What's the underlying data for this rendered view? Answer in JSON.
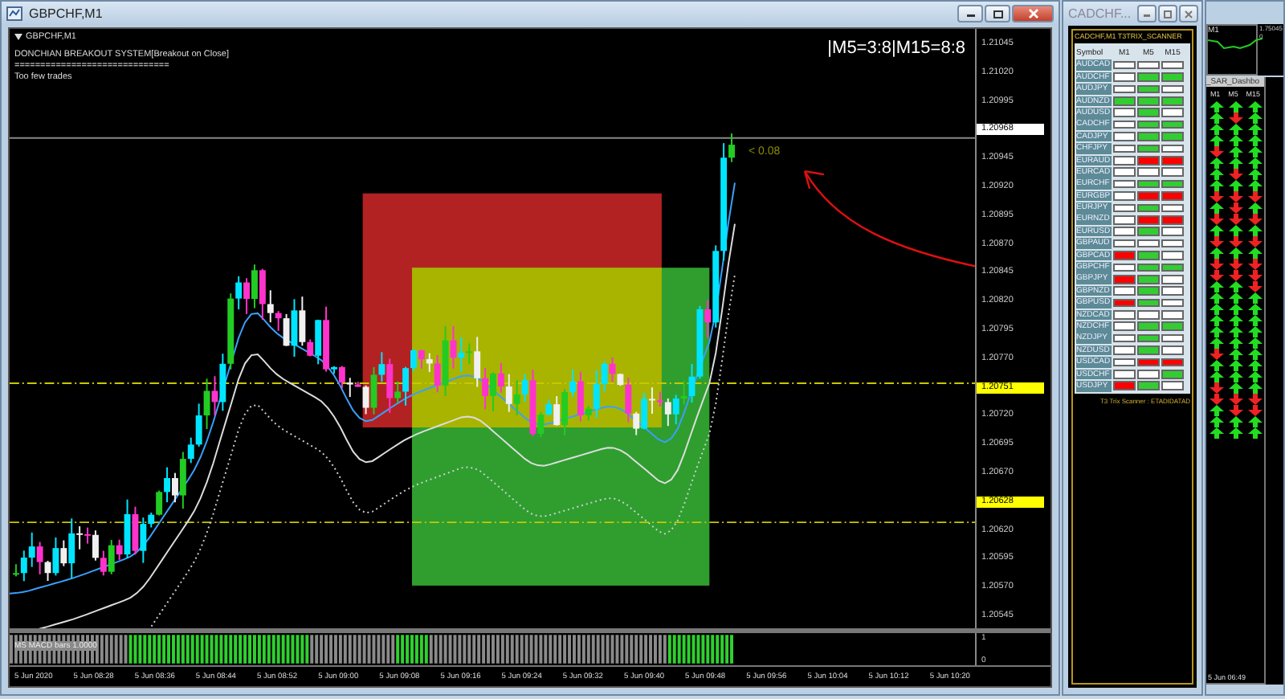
{
  "window": {
    "title": "GBPCHF,M1"
  },
  "chart": {
    "symbol": "GBPCHF,M1",
    "indicator_lines": [
      "DONCHIAN BREAKOUT SYSTEM[Breakout on Close]",
      "==============================",
      "Too few trades"
    ],
    "mtf_status": "|M5=3:8|M15=8:8",
    "price_note": "< 0.08",
    "price_axis": [
      {
        "label": "1.21045",
        "kind": "tick"
      },
      {
        "label": "1.21020",
        "kind": "tick"
      },
      {
        "label": "1.20995",
        "kind": "tick"
      },
      {
        "label": "1.20968",
        "kind": "current"
      },
      {
        "label": "1.20945",
        "kind": "tick"
      },
      {
        "label": "1.20920",
        "kind": "tick"
      },
      {
        "label": "1.20895",
        "kind": "tick"
      },
      {
        "label": "1.20870",
        "kind": "tick"
      },
      {
        "label": "1.20845",
        "kind": "tick"
      },
      {
        "label": "1.20820",
        "kind": "tick"
      },
      {
        "label": "1.20795",
        "kind": "tick"
      },
      {
        "label": "1.20770",
        "kind": "tick"
      },
      {
        "label": "1.20751",
        "kind": "level"
      },
      {
        "label": "1.20720",
        "kind": "tick"
      },
      {
        "label": "1.20695",
        "kind": "tick"
      },
      {
        "label": "1.20670",
        "kind": "tick"
      },
      {
        "label": "1.20628",
        "kind": "level"
      },
      {
        "label": "1.20620",
        "kind": "tick"
      },
      {
        "label": "1.20595",
        "kind": "tick"
      },
      {
        "label": "1.20570",
        "kind": "tick"
      },
      {
        "label": "1.20545",
        "kind": "tick"
      }
    ],
    "indicator": {
      "label": "MS MACD bars 1.0000",
      "scale": [
        "1",
        "0"
      ]
    },
    "time_axis": [
      "5 Jun 2020",
      "5 Jun 08:28",
      "5 Jun 08:36",
      "5 Jun 08:44",
      "5 Jun 08:52",
      "5 Jun 09:00",
      "5 Jun 09:08",
      "5 Jun 09:16",
      "5 Jun 09:24",
      "5 Jun 09:32",
      "5 Jun 09:40",
      "5 Jun 09:48",
      "5 Jun 09:56",
      "5 Jun 10:04",
      "5 Jun 10:12",
      "5 Jun 10:20"
    ]
  },
  "scanner": {
    "title": "CADCHF...",
    "header": "CADCHF,M1 T3TRIX_SCANNER",
    "columns": [
      "Symbol",
      "M1",
      "M5",
      "M15"
    ],
    "rows": [
      {
        "symbol": "AUDCAD",
        "cells": [
          {
            "color": "#ffffff"
          },
          {
            "color": "#ffffff"
          },
          {
            "color": "#ffffff"
          }
        ]
      },
      {
        "symbol": "AUDCHF",
        "cells": [
          {
            "color": "#ffffff"
          },
          {
            "color": "#33cc33"
          },
          {
            "color": "#33cc33"
          }
        ]
      },
      {
        "symbol": "AUDJPY",
        "cells": [
          {
            "color": "#ffffff"
          },
          {
            "color": "#33cc33"
          },
          {
            "color": "#ffffff"
          }
        ]
      },
      {
        "symbol": "AUDNZD",
        "cells": [
          {
            "color": "#33cc33"
          },
          {
            "color": "#33cc33"
          },
          {
            "color": "#33cc33"
          }
        ]
      },
      {
        "symbol": "AUDUSD",
        "cells": [
          {
            "color": "#ffffff"
          },
          {
            "color": "#33cc33"
          },
          {
            "color": "#ffffff"
          }
        ]
      },
      {
        "symbol": "CADCHF",
        "cells": [
          {
            "color": "#ffffff"
          },
          {
            "color": "#33cc33"
          },
          {
            "color": "#33cc33"
          }
        ]
      },
      {
        "symbol": "CADJPY",
        "cells": [
          {
            "color": "#ffffff"
          },
          {
            "color": "#33cc33"
          },
          {
            "color": "#33cc33"
          }
        ]
      },
      {
        "symbol": "CHFJPY",
        "cells": [
          {
            "color": "#ffffff"
          },
          {
            "color": "#33cc33"
          },
          {
            "color": "#ffffff"
          }
        ]
      },
      {
        "symbol": "EURAUD",
        "cells": [
          {
            "color": "#ffffff"
          },
          {
            "color": "#ff0000"
          },
          {
            "color": "#ff0000"
          }
        ]
      },
      {
        "symbol": "EURCAD",
        "cells": [
          {
            "color": "#ffffff"
          },
          {
            "color": "#ffffff"
          },
          {
            "color": "#ffffff"
          }
        ]
      },
      {
        "symbol": "EURCHF",
        "cells": [
          {
            "color": "#ffffff"
          },
          {
            "color": "#33cc33"
          },
          {
            "color": "#33cc33"
          }
        ]
      },
      {
        "symbol": "EURGBP",
        "cells": [
          {
            "color": "#ffffff"
          },
          {
            "color": "#ff0000"
          },
          {
            "color": "#ff0000"
          }
        ]
      },
      {
        "symbol": "EURJPY",
        "cells": [
          {
            "color": "#ffffff"
          },
          {
            "color": "#33cc33"
          },
          {
            "color": "#ffffff"
          }
        ]
      },
      {
        "symbol": "EURNZD",
        "cells": [
          {
            "color": "#ffffff"
          },
          {
            "color": "#ff0000"
          },
          {
            "color": "#ff0000"
          }
        ]
      },
      {
        "symbol": "EURUSD",
        "cells": [
          {
            "color": "#ffffff"
          },
          {
            "color": "#33cc33"
          },
          {
            "color": "#ffffff"
          }
        ]
      },
      {
        "symbol": "GBPAUD",
        "cells": [
          {
            "color": "#ffffff"
          },
          {
            "color": "#ffffff"
          },
          {
            "color": "#ffffff"
          }
        ]
      },
      {
        "symbol": "GBPCAD",
        "cells": [
          {
            "color": "#ff0000"
          },
          {
            "color": "#33cc33"
          },
          {
            "color": "#ffffff"
          }
        ]
      },
      {
        "symbol": "GBPCHF",
        "cells": [
          {
            "color": "#ffffff"
          },
          {
            "color": "#33cc33"
          },
          {
            "color": "#33cc33"
          }
        ]
      },
      {
        "symbol": "GBPJPY",
        "cells": [
          {
            "color": "#ff0000"
          },
          {
            "color": "#33cc33"
          },
          {
            "color": "#ffffff"
          }
        ]
      },
      {
        "symbol": "GBPNZD",
        "cells": [
          {
            "color": "#ffffff"
          },
          {
            "color": "#33cc33"
          },
          {
            "color": "#ffffff"
          }
        ]
      },
      {
        "symbol": "GBPUSD",
        "cells": [
          {
            "color": "#ff0000"
          },
          {
            "color": "#33cc33"
          },
          {
            "color": "#ffffff"
          }
        ]
      },
      {
        "symbol": "NZDCAD",
        "cells": [
          {
            "color": "#ffffff"
          },
          {
            "color": "#ffffff"
          },
          {
            "color": "#ffffff"
          }
        ]
      },
      {
        "symbol": "NZDCHF",
        "cells": [
          {
            "color": "#ffffff"
          },
          {
            "color": "#33cc33"
          },
          {
            "color": "#33cc33"
          }
        ]
      },
      {
        "symbol": "NZDJPY",
        "cells": [
          {
            "color": "#ffffff"
          },
          {
            "color": "#33cc33"
          },
          {
            "color": "#ffffff"
          }
        ]
      },
      {
        "symbol": "NZDUSD",
        "cells": [
          {
            "color": "#ffffff"
          },
          {
            "color": "#33cc33"
          },
          {
            "color": "#ffffff"
          }
        ]
      },
      {
        "symbol": "USDCAD",
        "cells": [
          {
            "color": "#ffffff"
          },
          {
            "color": "#ff0000"
          },
          {
            "color": "#ff0000"
          }
        ]
      },
      {
        "symbol": "USDCHF",
        "cells": [
          {
            "color": "#ffffff"
          },
          {
            "color": "#ffffff"
          },
          {
            "color": "#33cc33"
          }
        ]
      },
      {
        "symbol": "USDJPY",
        "cells": [
          {
            "color": "#ff0000"
          },
          {
            "color": "#33cc33"
          },
          {
            "color": "#ffffff"
          }
        ]
      }
    ],
    "footer": "T3 Trix Scanner : ETADIDATAD"
  },
  "dashboard": {
    "chart_label": "M1",
    "price": "1.75045",
    "scale": "0",
    "title": "_SAR_Dashbo",
    "columns": [
      "M1",
      "M5",
      "M15"
    ],
    "rows": [
      {
        "arrows": [
          {
            "kind": "up"
          },
          {
            "kind": "up"
          },
          {
            "kind": "up"
          }
        ]
      },
      {
        "arrows": [
          {
            "kind": "up"
          },
          {
            "kind": "down"
          },
          {
            "kind": "up"
          }
        ]
      },
      {
        "arrows": [
          {
            "kind": "up"
          },
          {
            "kind": "up"
          },
          {
            "kind": "up"
          }
        ]
      },
      {
        "arrows": [
          {
            "kind": "up"
          },
          {
            "kind": "up"
          },
          {
            "kind": "up"
          }
        ]
      },
      {
        "arrows": [
          {
            "kind": "down"
          },
          {
            "kind": "up"
          },
          {
            "kind": "up"
          }
        ]
      },
      {
        "arrows": [
          {
            "kind": "up"
          },
          {
            "kind": "up"
          },
          {
            "kind": "up"
          }
        ]
      },
      {
        "arrows": [
          {
            "kind": "up"
          },
          {
            "kind": "down"
          },
          {
            "kind": "up"
          }
        ]
      },
      {
        "arrows": [
          {
            "kind": "up"
          },
          {
            "kind": "up"
          },
          {
            "kind": "up"
          }
        ]
      },
      {
        "arrows": [
          {
            "kind": "down"
          },
          {
            "kind": "down"
          },
          {
            "kind": "down"
          }
        ]
      },
      {
        "arrows": [
          {
            "kind": "up"
          },
          {
            "kind": "down"
          },
          {
            "kind": "up"
          }
        ]
      },
      {
        "arrows": [
          {
            "kind": "down"
          },
          {
            "kind": "down"
          },
          {
            "kind": "down"
          }
        ]
      },
      {
        "arrows": [
          {
            "kind": "up"
          },
          {
            "kind": "up"
          },
          {
            "kind": "up"
          }
        ]
      },
      {
        "arrows": [
          {
            "kind": "down"
          },
          {
            "kind": "down"
          },
          {
            "kind": "down"
          }
        ]
      },
      {
        "arrows": [
          {
            "kind": "up"
          },
          {
            "kind": "up"
          },
          {
            "kind": "up"
          }
        ]
      },
      {
        "arrows": [
          {
            "kind": "down"
          },
          {
            "kind": "down"
          },
          {
            "kind": "down"
          }
        ]
      },
      {
        "arrows": [
          {
            "kind": "down"
          },
          {
            "kind": "down"
          },
          {
            "kind": "down"
          }
        ]
      },
      {
        "arrows": [
          {
            "kind": "up"
          },
          {
            "kind": "up"
          },
          {
            "kind": "down"
          }
        ]
      },
      {
        "arrows": [
          {
            "kind": "up"
          },
          {
            "kind": "up"
          },
          {
            "kind": "up"
          }
        ]
      },
      {
        "arrows": [
          {
            "kind": "up"
          },
          {
            "kind": "up"
          },
          {
            "kind": "up"
          }
        ]
      },
      {
        "arrows": [
          {
            "kind": "up"
          },
          {
            "kind": "up"
          },
          {
            "kind": "up"
          }
        ]
      },
      {
        "arrows": [
          {
            "kind": "up"
          },
          {
            "kind": "up"
          },
          {
            "kind": "up"
          }
        ]
      },
      {
        "arrows": [
          {
            "kind": "up"
          },
          {
            "kind": "up"
          },
          {
            "kind": "up"
          }
        ]
      },
      {
        "arrows": [
          {
            "kind": "down"
          },
          {
            "kind": "up"
          },
          {
            "kind": "up"
          }
        ]
      },
      {
        "arrows": [
          {
            "kind": "up"
          },
          {
            "kind": "up"
          },
          {
            "kind": "up"
          }
        ]
      },
      {
        "arrows": [
          {
            "kind": "up"
          },
          {
            "kind": "up"
          },
          {
            "kind": "up"
          }
        ]
      },
      {
        "arrows": [
          {
            "kind": "down"
          },
          {
            "kind": "up"
          },
          {
            "kind": "up"
          }
        ]
      },
      {
        "arrows": [
          {
            "kind": "down"
          },
          {
            "kind": "down"
          },
          {
            "kind": "down"
          }
        ]
      },
      {
        "arrows": [
          {
            "kind": "up"
          },
          {
            "kind": "down"
          },
          {
            "kind": "down"
          }
        ]
      },
      {
        "arrows": [
          {
            "kind": "up"
          },
          {
            "kind": "up"
          },
          {
            "kind": "up"
          }
        ]
      },
      {
        "arrows": [
          {
            "kind": "up"
          },
          {
            "kind": "up"
          },
          {
            "kind": "up"
          }
        ]
      }
    ],
    "time": "5 Jun 06:49"
  }
}
